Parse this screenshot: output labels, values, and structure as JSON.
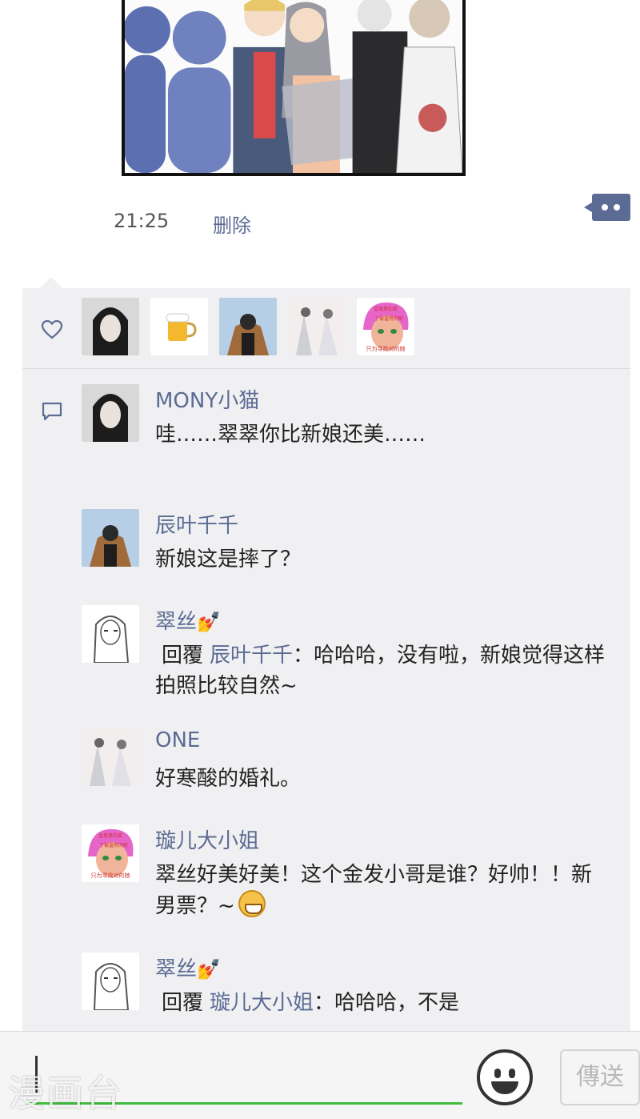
{
  "post": {
    "time": "21:25",
    "delete_label": "删除"
  },
  "likes": {
    "avatars": [
      "avatar-dark-hair-girl",
      "avatar-beer-mug",
      "avatar-winter-coat",
      "avatar-anime-couple",
      "avatar-pink-hair-anime"
    ]
  },
  "comments": [
    {
      "name": "MONY小猫",
      "text": "哇……翠翠你比新娘还美……"
    },
    {
      "name": "辰叶千千",
      "text": "新娘这是摔了？"
    },
    {
      "name": "翠丝",
      "name_emoji": "💅",
      "reply_label": "回覆",
      "reply_to": "辰叶千千",
      "text": "：哈哈哈，没有啦，新娘觉得这样拍照比较自然~"
    },
    {
      "name": "ONE",
      "text": "好寒酸的婚礼。"
    },
    {
      "name": "璇儿大小姐",
      "text": "翠丝好美好美！这个金发小哥是谁？好帅！！新男票？~"
    },
    {
      "name": "翠丝",
      "name_emoji": "💅",
      "reply_label": "回覆",
      "reply_to": "璇儿大小姐",
      "text": "：哈哈哈，不是"
    }
  ],
  "pink_avatar_caption": {
    "top": "金发男的笑",
    "middle": "了被雷劈的呢",
    "bottom": "只为寻找对的她"
  },
  "input": {
    "send_label": "傳送"
  },
  "watermark": "漫画台",
  "colors": {
    "name_blue": "#5b6b93",
    "panel_bg": "#f0f0f2",
    "input_underline": "#3fbd3f"
  }
}
